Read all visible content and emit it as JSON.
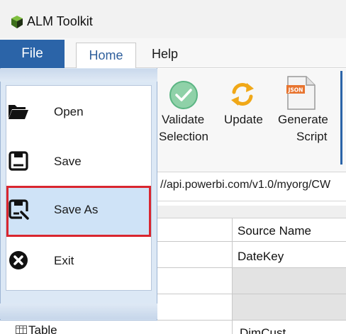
{
  "app": {
    "title": "ALM Toolkit",
    "icon": "alm-toolkit-logo-icon"
  },
  "menubar": {
    "file_label": "File",
    "home_label": "Home",
    "help_label": "Help",
    "active_color": "#2b64a8"
  },
  "ribbon": {
    "validate": {
      "line1": "Validate",
      "line2": "Selection",
      "icon": "check-circle-icon"
    },
    "update": {
      "label": "Update",
      "icon": "refresh-icon"
    },
    "generate": {
      "line1": "Generate",
      "line2": "Script",
      "icon": "json-file-icon",
      "badge": "JSON"
    }
  },
  "connection": {
    "url": "//api.powerbi.com/v1.0/myorg/CW"
  },
  "grid": {
    "header_source_name": "Source Name",
    "rows": [
      {
        "source_name": "DateKey"
      }
    ],
    "bottom_row_label": "Table",
    "bottom_row_right": "DimCust"
  },
  "file_menu": {
    "items": [
      {
        "label": "Open",
        "icon": "folder-open-icon"
      },
      {
        "label": "Save",
        "icon": "save-icon"
      },
      {
        "label": "Save As",
        "icon": "save-as-icon",
        "selected": true
      },
      {
        "label": "Exit",
        "icon": "exit-icon"
      }
    ],
    "highlight_color": "#d9262f"
  }
}
